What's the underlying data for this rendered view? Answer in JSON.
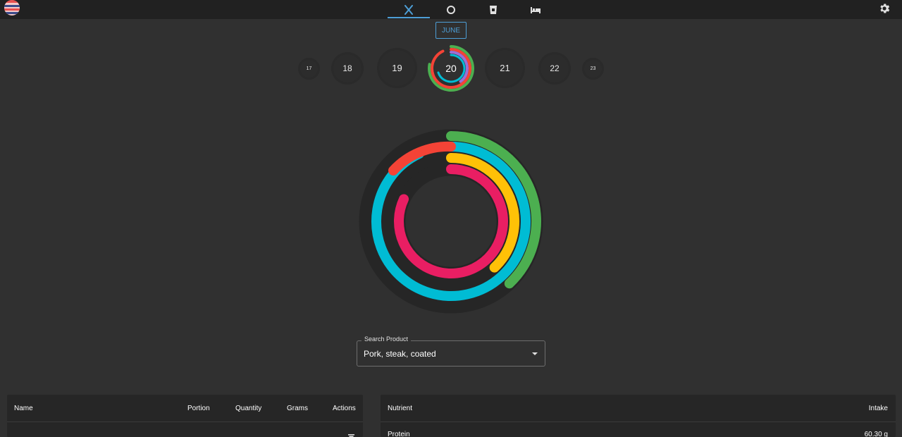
{
  "nav": {
    "tabs": [
      {
        "icon": "fork-knife-icon",
        "active": true
      },
      {
        "icon": "ring-chart-icon",
        "active": false
      },
      {
        "icon": "cup-icon",
        "active": false
      },
      {
        "icon": "bed-icon",
        "active": false
      }
    ],
    "settings_icon": "gear-icon",
    "logo_icon": "striped-ball-logo"
  },
  "calendar": {
    "month": "JUNE",
    "days": [
      {
        "label": "17"
      },
      {
        "label": "18"
      },
      {
        "label": "19"
      },
      {
        "label": "20",
        "selected": true
      },
      {
        "label": "21"
      },
      {
        "label": "22"
      },
      {
        "label": "23"
      }
    ]
  },
  "rings": {
    "colors": {
      "outer": "#4caf50",
      "second": "#00bcd4",
      "third": "#ffc107",
      "inner": "#e91e63",
      "extra": "#f44336"
    },
    "progress": {
      "outer": 0.38,
      "second": 0.93,
      "third": 0.38,
      "inner": 0.82
    }
  },
  "search": {
    "label": "Search Product",
    "value": "Pork, steak, coated"
  },
  "food_table": {
    "headers": {
      "name": "Name",
      "portion": "Portion",
      "quantity": "Quantity",
      "grams": "Grams",
      "actions": "Actions"
    }
  },
  "nutrient_table": {
    "headers": {
      "nutrient": "Nutrient",
      "intake": "Intake"
    },
    "rows": [
      {
        "nutrient": "Protein",
        "intake": "60.30 g"
      }
    ]
  }
}
